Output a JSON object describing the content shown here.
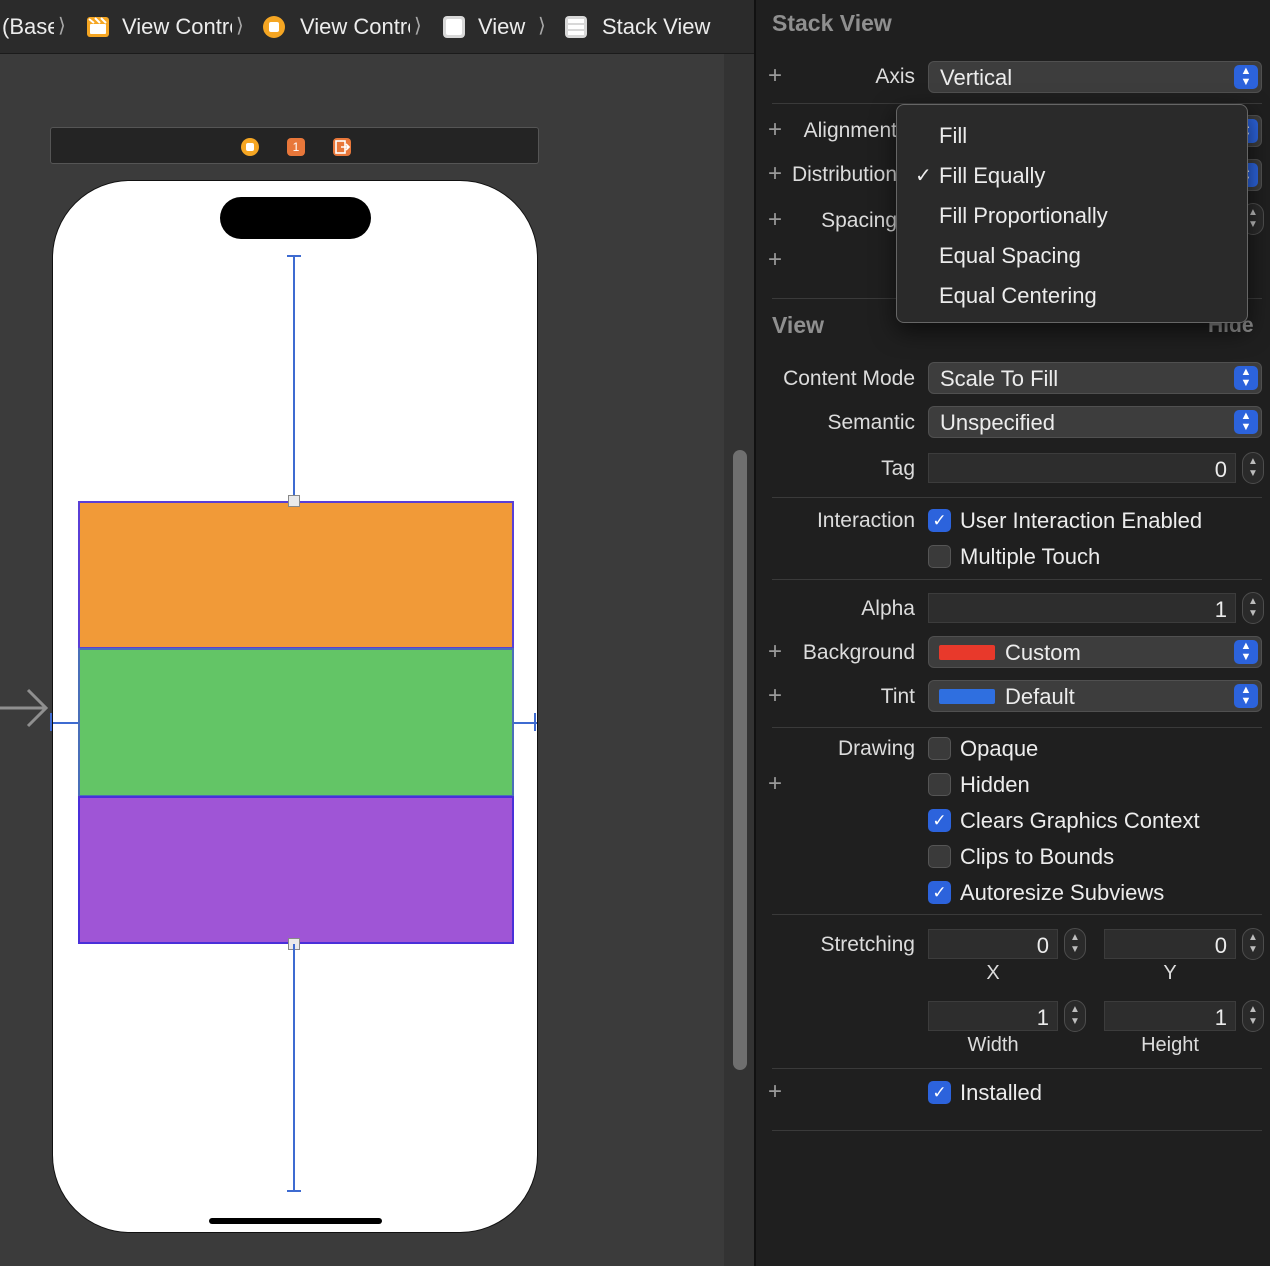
{
  "breadcrumb": {
    "items": [
      {
        "label": "(Base)",
        "icon": "base-localization"
      },
      {
        "label": "View Controller Scene",
        "icon": "scene-icon"
      },
      {
        "label": "View Controller",
        "icon": "view-controller-icon"
      },
      {
        "label": "View",
        "icon": "view-icon"
      },
      {
        "label": "Stack View",
        "icon": "stack-view-icon"
      }
    ],
    "separator": "⟩"
  },
  "scene_dock": {
    "icons": [
      "view-controller-icon",
      "first-responder-icon",
      "exit-icon"
    ],
    "first_responder_glyph": "1"
  },
  "canvas": {
    "stack_colors": [
      "#f19a38",
      "#63c566",
      "#9f55d6"
    ]
  },
  "inspector": {
    "stack_view": {
      "title": "Stack View",
      "axis_label": "Axis",
      "axis_value": "Vertical",
      "alignment_label": "Alignment",
      "distribution_label": "Distribution",
      "spacing_label": "Spacing"
    },
    "distribution_menu": {
      "options": [
        "Fill",
        "Fill Equally",
        "Fill Proportionally",
        "Equal Spacing",
        "Equal Centering"
      ],
      "selected": "Fill Equally",
      "check_glyph": "✓"
    },
    "view": {
      "title": "View",
      "hide_label": "Hide",
      "content_mode_label": "Content Mode",
      "content_mode_value": "Scale To Fill",
      "semantic_label": "Semantic",
      "semantic_value": "Unspecified",
      "tag_label": "Tag",
      "tag_value": "0",
      "interaction_label": "Interaction",
      "user_interaction_label": "User Interaction Enabled",
      "multiple_touch_label": "Multiple Touch",
      "alpha_label": "Alpha",
      "alpha_value": "1",
      "background_label": "Background",
      "background_value": "Custom",
      "background_color": "#e8392b",
      "tint_label": "Tint",
      "tint_value": "Default",
      "tint_color": "#2f6fe0",
      "drawing_label": "Drawing",
      "opaque_label": "Opaque",
      "hidden_label": "Hidden",
      "clears_label": "Clears Graphics Context",
      "clips_label": "Clips to Bounds",
      "autoresize_label": "Autoresize Subviews",
      "stretching_label": "Stretching",
      "stretch_x": "0",
      "stretch_y": "0",
      "x_label": "X",
      "y_label": "Y",
      "stretch_width": "1",
      "stretch_height": "1",
      "width_label": "Width",
      "height_label": "Height",
      "installed_label": "Installed"
    },
    "checkboxes": {
      "user_interaction": true,
      "multiple_touch": false,
      "opaque": false,
      "hidden": false,
      "clears": true,
      "clips": false,
      "autoresize": true,
      "installed": true
    },
    "accent_color": "#2c63dc"
  }
}
